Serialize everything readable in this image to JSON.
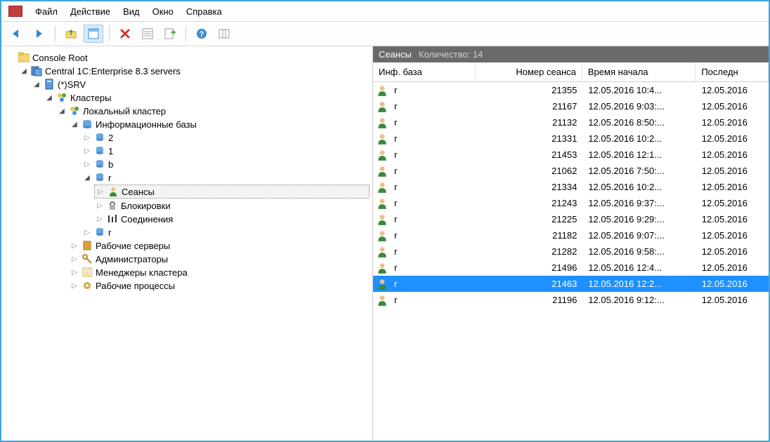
{
  "menu": {
    "file": "Файл",
    "action": "Действие",
    "view": "Вид",
    "window": "Окно",
    "help": "Справка"
  },
  "toolbar_icons": [
    "back",
    "forward",
    "up",
    "props",
    "delete",
    "refresh",
    "export",
    "help",
    "columns"
  ],
  "tree": {
    "root": "Console Root",
    "central": "Central 1C:Enterprise 8.3 servers",
    "srv": "(*)SRV",
    "clusters": "Кластеры",
    "local_cluster": "Локальный кластер",
    "infobases": "Информационные базы",
    "db2": "2",
    "db1": "1",
    "dbb": "b",
    "dbr": "r",
    "sessions": "Сеансы",
    "locks": "Блокировки",
    "connections": "Соединения",
    "dbr2": "r",
    "work_servers": "Рабочие серверы",
    "admins": "Администраторы",
    "cluster_mgrs": "Менеджеры кластера",
    "work_procs": "Рабочие процессы"
  },
  "right": {
    "title": "Сеансы",
    "count_label": "Количество:",
    "count": 14,
    "columns": {
      "infobase": "Инф. база",
      "session": "Номер сеанса",
      "start": "Время начала",
      "last": "Последн"
    }
  },
  "sessions": [
    {
      "ib": "r",
      "num": 21355,
      "start": "12.05.2016 10:4...",
      "last": "12.05.2016"
    },
    {
      "ib": "r",
      "num": 21167,
      "start": "12.05.2016 9:03:...",
      "last": "12.05.2016"
    },
    {
      "ib": "r",
      "num": 21132,
      "start": "12.05.2016 8:50:...",
      "last": "12.05.2016"
    },
    {
      "ib": "r",
      "num": 21331,
      "start": "12.05.2016 10:2...",
      "last": "12.05.2016"
    },
    {
      "ib": "r",
      "num": 21453,
      "start": "12.05.2016 12:1...",
      "last": "12.05.2016"
    },
    {
      "ib": "r",
      "num": 21062,
      "start": "12.05.2016 7:50:...",
      "last": "12.05.2016"
    },
    {
      "ib": "r",
      "num": 21334,
      "start": "12.05.2016 10:2...",
      "last": "12.05.2016"
    },
    {
      "ib": "r",
      "num": 21243,
      "start": "12.05.2016 9:37:...",
      "last": "12.05.2016"
    },
    {
      "ib": "r",
      "num": 21225,
      "start": "12.05.2016 9:29:...",
      "last": "12.05.2016"
    },
    {
      "ib": "r",
      "num": 21182,
      "start": "12.05.2016 9:07:...",
      "last": "12.05.2016"
    },
    {
      "ib": "r",
      "num": 21282,
      "start": "12.05.2016 9:58:...",
      "last": "12.05.2016"
    },
    {
      "ib": "r",
      "num": 21496,
      "start": "12.05.2016 12:4...",
      "last": "12.05.2016"
    },
    {
      "ib": "r",
      "num": 21463,
      "start": "12.05.2016 12:2...",
      "last": "12.05.2016",
      "selected": true
    },
    {
      "ib": "r",
      "num": 21196,
      "start": "12.05.2016 9:12:...",
      "last": "12.05.2016"
    }
  ]
}
